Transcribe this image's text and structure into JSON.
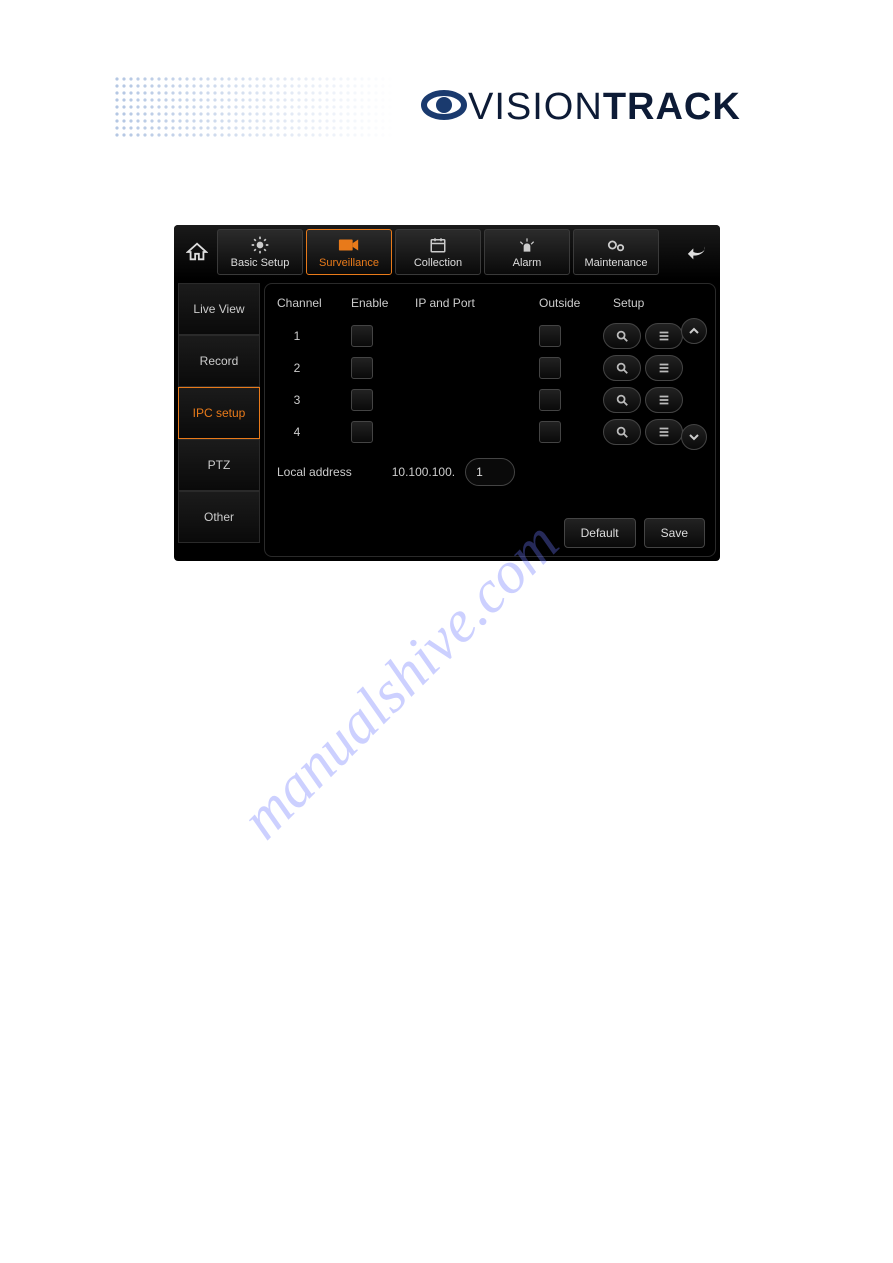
{
  "header": {
    "brand_vision": "VISION",
    "brand_track": "TRACK"
  },
  "nav_tabs": [
    {
      "label": "Basic Setup",
      "icon": "gear"
    },
    {
      "label": "Surveillance",
      "icon": "camera",
      "active": true
    },
    {
      "label": "Collection",
      "icon": "calendar"
    },
    {
      "label": "Alarm",
      "icon": "beacon"
    },
    {
      "label": "Maintenance",
      "icon": "gears"
    }
  ],
  "side_tabs": [
    {
      "label": "Live View"
    },
    {
      "label": "Record"
    },
    {
      "label": "IPC setup",
      "active": true
    },
    {
      "label": "PTZ"
    },
    {
      "label": "Other"
    }
  ],
  "columns": {
    "channel": "Channel",
    "enable": "Enable",
    "ip_port": "IP and Port",
    "outside": "Outside",
    "setup": "Setup"
  },
  "rows": [
    {
      "channel": "1"
    },
    {
      "channel": "2"
    },
    {
      "channel": "3"
    },
    {
      "channel": "4"
    }
  ],
  "local": {
    "label": "Local address",
    "prefix": "10.100.100.",
    "value": "1"
  },
  "buttons": {
    "default": "Default",
    "save": "Save"
  },
  "watermark": "manualshive.com"
}
